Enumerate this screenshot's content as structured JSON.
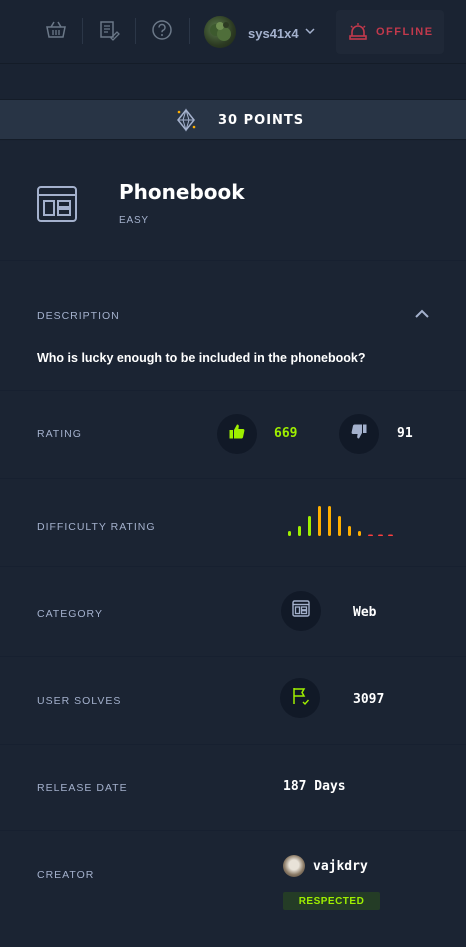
{
  "topbar": {
    "username": "sys41x4",
    "status_label": "OFFLINE",
    "icons": [
      "basket-icon",
      "notes-icon",
      "help-icon",
      "chevron-down-icon",
      "vpn-status-icon"
    ]
  },
  "points": {
    "label": "30 POINTS",
    "icon": "diamond-icon"
  },
  "challenge": {
    "title": "Phonebook",
    "difficulty": "EASY",
    "icon": "web-window-icon"
  },
  "description": {
    "label": "DESCRIPTION",
    "text": "Who is lucky enough to be included in the phonebook?"
  },
  "rating": {
    "label": "RATING",
    "likes": "669",
    "dislikes": "91"
  },
  "difficulty_rating": {
    "label": "DIFFICULTY RATING",
    "levels": [
      1,
      2,
      4,
      6,
      6,
      4,
      2,
      1,
      0.2,
      0.2,
      0.2
    ],
    "colors": [
      "#9fef00",
      "#9fef00",
      "#9fef00",
      "#ffaf00",
      "#ffaf00",
      "#ffaf00",
      "#ffaf00",
      "#ffaf00",
      "#ff3e3e",
      "#ff3e3e",
      "#ff3e3e"
    ]
  },
  "category": {
    "label": "CATEGORY",
    "value": "Web",
    "icon": "web-window-icon"
  },
  "user_solves": {
    "label": "USER SOLVES",
    "value": "3097",
    "icon": "flag-icon"
  },
  "release_date": {
    "label": "RELEASE DATE",
    "value": "187 Days"
  },
  "creator": {
    "label": "CREATOR",
    "name": "vajkdry",
    "badge": "RESPECTED"
  },
  "colors": {
    "accent_green": "#9fef00",
    "offline_red": "#c2394c",
    "label": "#a4b1cd",
    "background": "#1a2332"
  }
}
